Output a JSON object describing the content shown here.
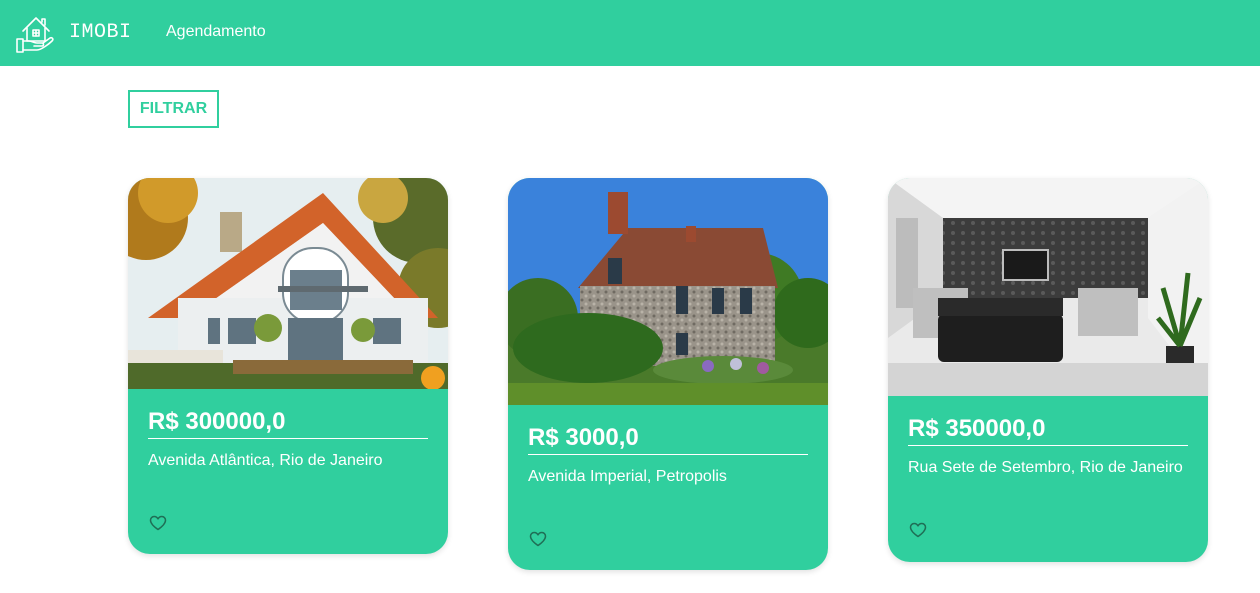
{
  "navbar": {
    "brand": "IMOBI",
    "link_agendamento": "Agendamento",
    "background_color": "#30cf9e",
    "logo_icon": "house-in-hand-icon"
  },
  "toolbar": {
    "filter_label": "FILTRAR"
  },
  "listings": [
    {
      "price": "R$ 300000,0",
      "address": "Avenida Atlântica, Rio de Janeiro",
      "image": "white-house-with-orange-roof-photo",
      "favorite_icon": "heart-outline-icon"
    },
    {
      "price": "R$ 3000,0",
      "address": "Avenida Imperial, Petropolis",
      "image": "stone-cottage-with-garden-photo",
      "favorite_icon": "heart-outline-icon"
    },
    {
      "price": "R$ 350000,0",
      "address": "Rua Sete de Setembro, Rio de Janeiro",
      "image": "modern-living-room-photo",
      "favorite_icon": "heart-outline-icon"
    }
  ],
  "colors": {
    "accent": "#30cf9e",
    "text_on_accent": "#ffffff"
  }
}
